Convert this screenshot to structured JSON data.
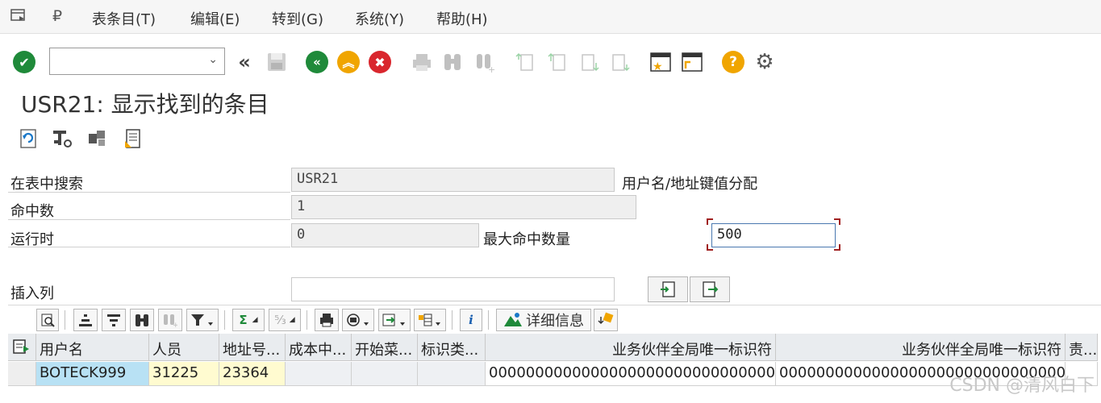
{
  "menu": {
    "items": [
      "表条目(T)",
      "编辑(E)",
      "转到(G)",
      "系统(Y)",
      "帮助(H)"
    ]
  },
  "toolbar": {
    "command_field_value": "",
    "icons": [
      "enter-icon",
      "back-double-icon",
      "save-icon",
      "back-icon",
      "exit-icon",
      "cancel-icon",
      "print-icon",
      "find-icon",
      "find-next-icon",
      "first-page-icon",
      "previous-page-icon",
      "next-page-icon",
      "last-page-icon",
      "create-session-icon",
      "shortcut-icon",
      "help-icon",
      "settings-icon"
    ]
  },
  "page": {
    "title": "USR21: 显示找到的条目"
  },
  "app_toolbar": {
    "icons": [
      "refresh-icon",
      "table-settings-icon",
      "structure-icon",
      "list-icon"
    ]
  },
  "form": {
    "search_table_label": "在表中搜索",
    "search_table_value": "USR21",
    "search_table_desc": "用户名/地址键值分配",
    "hits_label": "命中数",
    "hits_value": "1",
    "runtime_label": "运行时",
    "runtime_value": "0",
    "max_hits_label": "最大命中数量",
    "max_hits_value": "500",
    "insert_col_label": "插入列",
    "insert_col_value": ""
  },
  "alv_toolbar": {
    "details_label": "详细信息"
  },
  "grid": {
    "headers": [
      "用户名",
      "人员",
      "地址号...",
      "成本中...",
      "开始菜...",
      "标识类...",
      "业务伙伴全局唯一标识符",
      "业务伙伴全局唯一标识符",
      "责..."
    ],
    "rows": [
      [
        "BOTECK999",
        "31225",
        "23364",
        "",
        "",
        "",
        "00000000000000000000000000000000",
        "00000000000000000000000000000000",
        ""
      ]
    ]
  },
  "watermark": "CSDN @清风白下"
}
